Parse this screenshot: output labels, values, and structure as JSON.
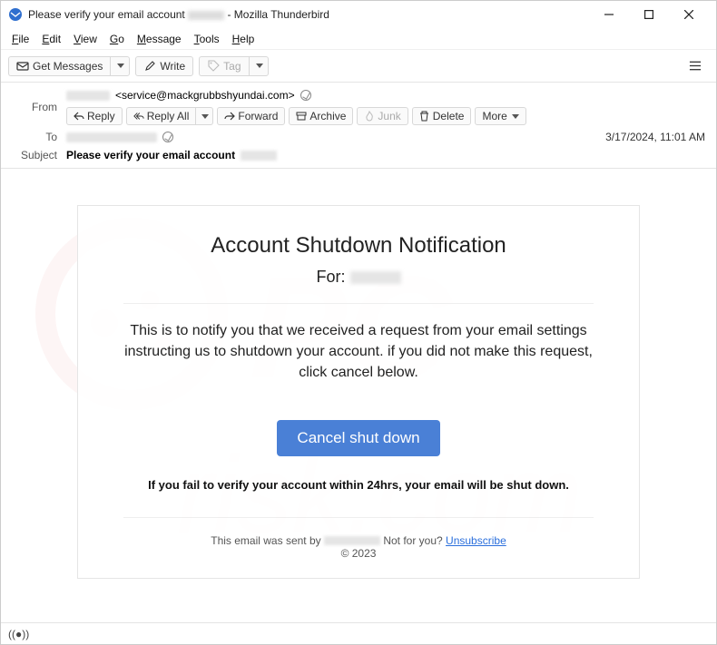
{
  "window": {
    "title_prefix": "Please verify your email account",
    "title_suffix": "- Mozilla Thunderbird"
  },
  "menu": {
    "file": "File",
    "edit": "Edit",
    "view": "View",
    "go": "Go",
    "message": "Message",
    "tools": "Tools",
    "help": "Help"
  },
  "toolbar": {
    "get_messages": "Get Messages",
    "write": "Write",
    "tag": "Tag"
  },
  "headers": {
    "from_label": "From",
    "from_email": "<service@mackgrubbshyundai.com>",
    "to_label": "To",
    "subject_label": "Subject",
    "subject_value": "Please verify your email account",
    "datetime": "3/17/2024, 11:01 AM",
    "actions": {
      "reply": "Reply",
      "reply_all": "Reply All",
      "forward": "Forward",
      "archive": "Archive",
      "junk": "Junk",
      "delete": "Delete",
      "more": "More"
    }
  },
  "email": {
    "heading": "Account Shutdown Notification",
    "for_label": "For:",
    "body": "This is to notify you that we received a request from your email settings instructing us to shutdown your account. if you did not make this request, click cancel below.",
    "button": "Cancel shut down",
    "warning": "If you fail to verify your account within 24hrs, your email will be shut down.",
    "footer_sent_prefix": "This email was sent by",
    "footer_notyou": "Not for you?",
    "footer_unsub": "Unsubscribe",
    "footer_copyright": "© 2023"
  }
}
